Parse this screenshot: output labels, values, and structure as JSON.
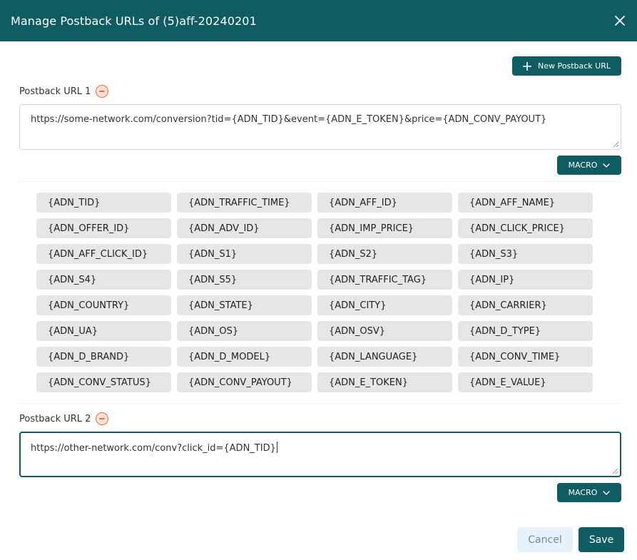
{
  "modal": {
    "title": "Manage Postback URLs of (5)aff-20240201",
    "close_icon": "close-icon"
  },
  "toolbar": {
    "new_url_label": "New Postback URL",
    "new_url_icon": "plus-icon"
  },
  "postbacks": [
    {
      "label": "Postback URL 1",
      "value": "https://some-network.com/conversion?tid={ADN_TID}&event={ADN_E_TOKEN}&price={ADN_CONV_PAYOUT}",
      "macro_label": "MACRO",
      "macro_expanded": true
    },
    {
      "label": "Postback URL 2",
      "value": "https://other-network.com/conv?click_id={ADN_TID}",
      "macro_label": "MACRO",
      "macro_expanded": false
    }
  ],
  "macros": [
    "{ADN_TID}",
    "{ADN_TRAFFIC_TIME}",
    "{ADN_AFF_ID}",
    "{ADN_AFF_NAME}",
    "{ADN_OFFER_ID}",
    "{ADN_ADV_ID}",
    "{ADN_IMP_PRICE}",
    "{ADN_CLICK_PRICE}",
    "{ADN_AFF_CLICK_ID}",
    "{ADN_S1}",
    "{ADN_S2}",
    "{ADN_S3}",
    "{ADN_S4}",
    "{ADN_S5}",
    "{ADN_TRAFFIC_TAG}",
    "{ADN_IP}",
    "{ADN_COUNTRY}",
    "{ADN_STATE}",
    "{ADN_CITY}",
    "{ADN_CARRIER}",
    "{ADN_UA}",
    "{ADN_OS}",
    "{ADN_OSV}",
    "{ADN_D_TYPE}",
    "{ADN_D_BRAND}",
    "{ADN_D_MODEL}",
    "{ADN_LANGUAGE}",
    "{ADN_CONV_TIME}",
    "{ADN_CONV_STATUS}",
    "{ADN_CONV_PAYOUT}",
    "{ADN_E_TOKEN}",
    "{ADN_E_VALUE}"
  ],
  "footer": {
    "cancel_label": "Cancel",
    "save_label": "Save"
  },
  "colors": {
    "primary": "#0f5c63",
    "remove_accent": "#f26b3a",
    "chip_bg": "#e6e6e6",
    "cancel_bg": "#e7f1fa"
  }
}
